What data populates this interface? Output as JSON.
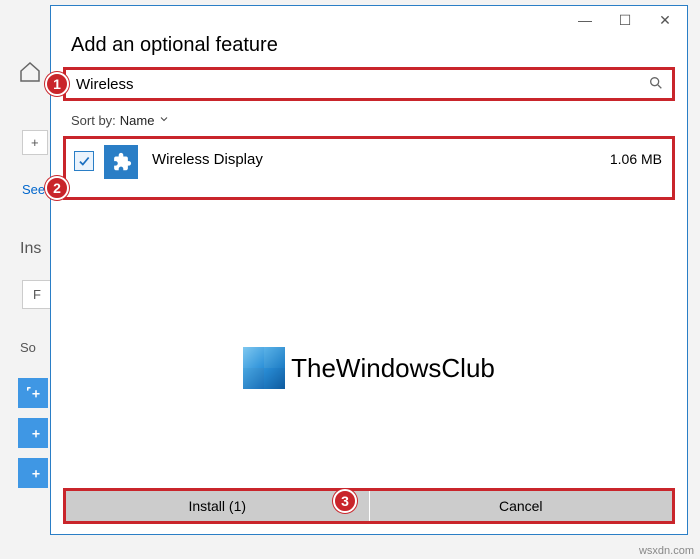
{
  "background": {
    "see_link": "See",
    "installed_partial": "Ins",
    "f_partial": "F",
    "sort_partial": "So"
  },
  "titlebar": {
    "minimize_glyph": "—",
    "maximize_glyph": "☐",
    "close_glyph": "✕"
  },
  "dialog": {
    "title": "Add an optional feature",
    "search": {
      "value": "Wireless",
      "placeholder": ""
    },
    "sort": {
      "label": "Sort by:",
      "value": "Name"
    },
    "feature": {
      "checked": true,
      "name": "Wireless Display",
      "size": "1.06 MB"
    },
    "buttons": {
      "install": "Install (1)",
      "cancel": "Cancel"
    }
  },
  "badges": {
    "one": "1",
    "two": "2",
    "three": "3"
  },
  "watermark": "TheWindowsClub",
  "attribution": "wsxdn.com"
}
